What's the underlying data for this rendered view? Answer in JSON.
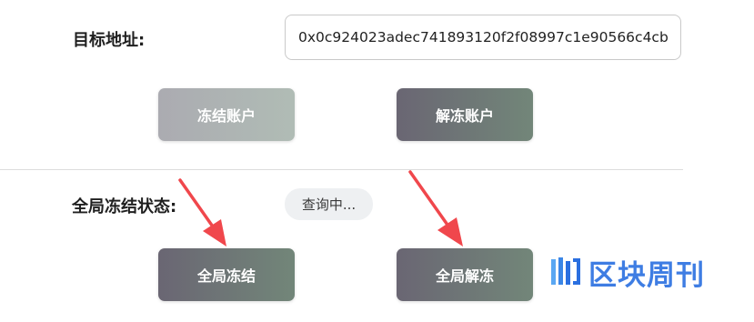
{
  "target": {
    "label": "目标地址:",
    "address_value": "0x0c924023adec741893120f2f08997c1e90566c4cb"
  },
  "account_actions": {
    "freeze_label": "冻结账户",
    "unfreeze_label": "解冻账户"
  },
  "global": {
    "status_label": "全局冻结状态:",
    "status_value": "查询中...",
    "freeze_label": "全局冻结",
    "unfreeze_label": "全局解冻"
  },
  "watermark": {
    "text": "区块周刊"
  },
  "colors": {
    "button_dark_start": "#6a6673",
    "button_dark_end": "#728679",
    "button_disabled_start": "#ababb1",
    "button_disabled_end": "#b0bcb5",
    "arrow": "#f0474c",
    "watermark": "#2a6fe0"
  }
}
